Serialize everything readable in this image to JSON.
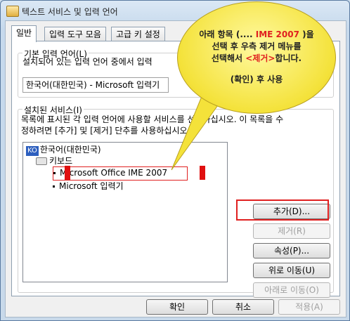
{
  "window": {
    "title": "텍스트 서비스 및 입력 언어"
  },
  "tabs": [
    {
      "label": "일반"
    },
    {
      "label": "입력 도구 모음"
    },
    {
      "label": "고급 키 설정"
    }
  ],
  "default_language": {
    "group_label": "기본 입력 언어(L)",
    "description": "설치되어 있는 입력 언어 중에서 입력",
    "selected_value": "한국어(대한민국) - Microsoft 입력기"
  },
  "installed_services": {
    "group_label": "설치된 서비스(I)",
    "description_line1": "목록에 표시된 각 입력 언어에 사용할 서비스를 선택하십시오. 이 목록을 수",
    "description_line2": "정하려면 [추가] 및 [제거] 단추를 사용하십시오.",
    "tree": {
      "language_badge": "KO",
      "language": "한국어(대한민국)",
      "category": "키보드",
      "items": [
        "Microsoft Office IME 2007",
        "Microsoft 입력기"
      ]
    },
    "buttons": {
      "add": "추가(D)...",
      "remove": "제거(R)",
      "properties": "속성(P)...",
      "move_up": "위로 이동(U)",
      "move_down": "아래로 이동(O)"
    }
  },
  "footer": {
    "ok": "확인",
    "cancel": "취소",
    "apply": "적용(A)"
  },
  "callout": {
    "line1_pre": "아래 항목 (.... ",
    "line1_highlight": "IME 2007",
    "line1_post": " )을",
    "line2": "선택 후 우측 제거 메뉴를",
    "line3_pre": "선택해서 ",
    "line3_highlight": "<제거>",
    "line3_post": "합니다.",
    "line4": "(확인) 후 사용"
  },
  "colors": {
    "highlight": "#e02020",
    "callout": "#f4e23a"
  }
}
